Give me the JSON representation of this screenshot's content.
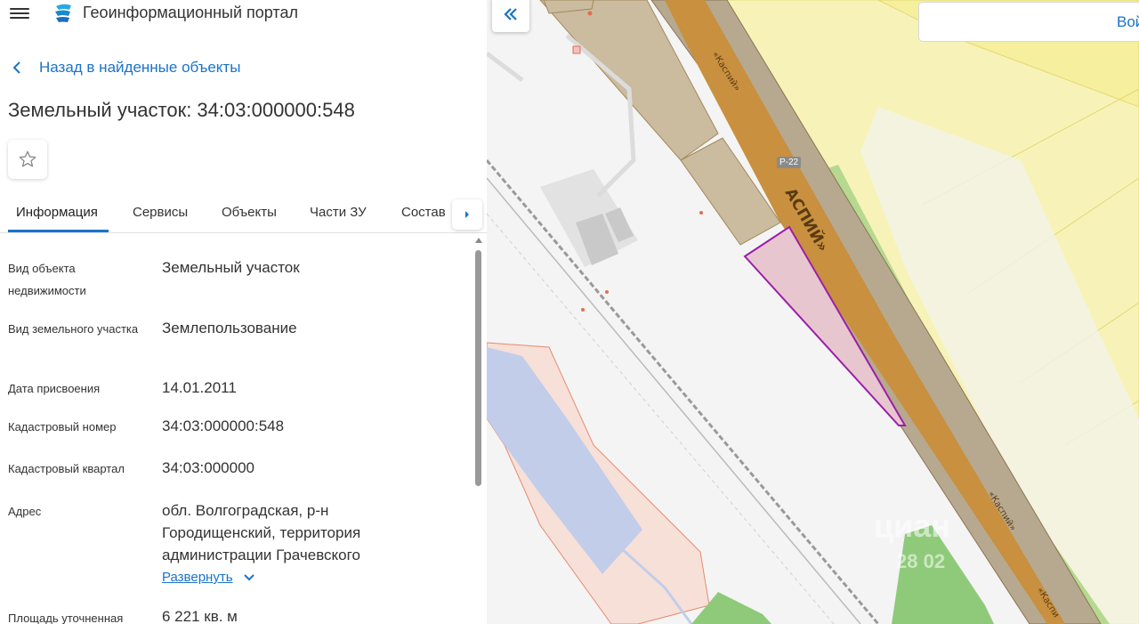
{
  "header": {
    "app_title": "Геоинформационный портал"
  },
  "nav": {
    "back_label": "Назад в найденные объекты"
  },
  "page": {
    "title": "Земельный участок: 34:03:000000:548"
  },
  "tabs": [
    {
      "label": "Информация",
      "active": true
    },
    {
      "label": "Сервисы"
    },
    {
      "label": "Объекты"
    },
    {
      "label": "Части ЗУ"
    },
    {
      "label": "Состав"
    }
  ],
  "info": {
    "rows": [
      {
        "label": "Вид объекта недвижимости",
        "value": "Земельный участок"
      },
      {
        "label": "Вид земельного участка",
        "value": "Землепользование"
      },
      {
        "label": "Дата присвоения",
        "value": "14.01.2011"
      },
      {
        "label": "Кадастровый номер",
        "value": "34:03:000000:548"
      },
      {
        "label": "Кадастровый квартал",
        "value": "34:03:000000"
      },
      {
        "label": "Адрес",
        "value": "обл. Волгоградская, р-н Городищенский, территория администрации Грачевского"
      },
      {
        "label": "Площадь уточненная",
        "value": "6 221 кв. м"
      }
    ],
    "expand_label": "Развернуть"
  },
  "map": {
    "search_label": "Вой",
    "route_badge": "Р-22",
    "road_labels": [
      "«Каспий»",
      "АСПИЙ»",
      "«Каспий»",
      "«Каспи"
    ],
    "watermark": "циан",
    "watermark_sub": "28  02"
  },
  "colors": {
    "accent": "#1a73c9",
    "road": "#c8903f",
    "road_border": "#a99a80",
    "parcel_highlight": "#9b1fa8",
    "parcel_fill": "#e8c6d0",
    "zone_yellow": "#f7f3b8",
    "water": "#c2cdea"
  },
  "icons": {
    "menu": "hamburger-menu-icon",
    "logo": "portal-logo-icon",
    "back": "chevron-left-icon",
    "favorite": "star-outline-icon",
    "tabs_next": "caret-right-icon",
    "expand": "chevron-down-icon",
    "collapse_panel": "double-chevron-left-icon"
  }
}
